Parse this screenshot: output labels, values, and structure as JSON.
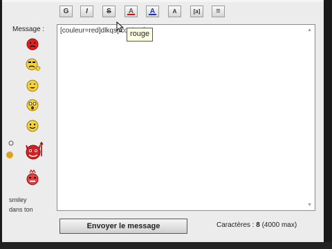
{
  "toolbar": {
    "bold_label": "G",
    "italic_label": "I",
    "strike_label": "S",
    "text_color_label": "A",
    "highlight_label": "A",
    "size_label": "A",
    "code_label": "[a]",
    "list_label": "≡"
  },
  "colors": {
    "text_color_underline": "#d01010",
    "highlight_underline": "#2233aa"
  },
  "sidebar": {
    "message_label": "Message :",
    "smileys": [
      "angry-smiley-icon",
      "sad-smiley-icon",
      "laughing-smiley-icon",
      "surprised-smiley-icon",
      "happy-smiley-icon",
      "devil-smiley-icon",
      "ouch-smiley-icon"
    ],
    "text_line1": "smiley",
    "text_line2": "dans ton"
  },
  "editor": {
    "content": "[couleur=red]dlkqs[/couleur]"
  },
  "tooltip": {
    "text": "rouge"
  },
  "footer": {
    "send_label": "Envoyer le message",
    "char_count_label": "Caractères :",
    "char_count_value": "8",
    "char_max": "(4000 max)"
  }
}
